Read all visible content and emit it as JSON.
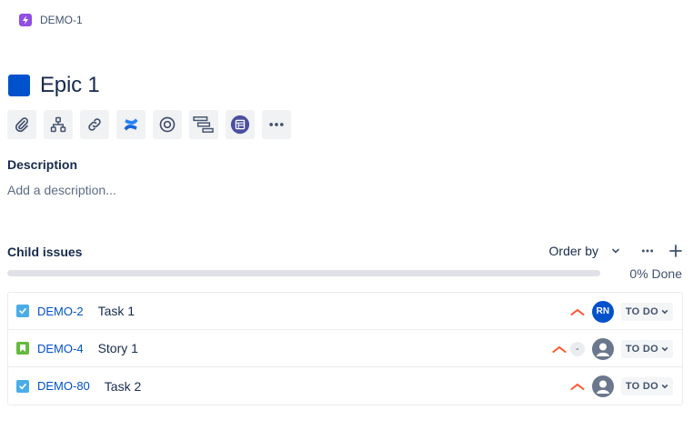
{
  "breadcrumb": {
    "key": "DEMO-1",
    "icon": "lightning-icon",
    "color": "#904ee2"
  },
  "issue": {
    "title": "Epic 1",
    "color": "#0052cc"
  },
  "toolbar": {
    "buttons": [
      "attachment-icon",
      "child-issue-icon",
      "link-icon",
      "confluence-icon",
      "target-icon",
      "roadmap-icon",
      "app-icon",
      "more-icon"
    ]
  },
  "description": {
    "label": "Description",
    "placeholder": "Add a description..."
  },
  "child_issues": {
    "label": "Child issues",
    "order_by": "Order by",
    "progress_percent": 0,
    "progress_text": "0% Done",
    "rows": [
      {
        "type": "task",
        "key": "DEMO-2",
        "summary": "Task 1",
        "priority": "high",
        "estimate": "",
        "assignee": "RN",
        "status": "TO DO"
      },
      {
        "type": "story",
        "key": "DEMO-4",
        "summary": "Story 1",
        "priority": "high",
        "estimate": "-",
        "assignee": "",
        "status": "TO DO"
      },
      {
        "type": "task",
        "key": "DEMO-80",
        "summary": "Task 2",
        "priority": "high",
        "estimate": "",
        "assignee": "",
        "status": "TO DO"
      }
    ]
  },
  "colors": {
    "task": "#4bade8",
    "story": "#63ba3c",
    "priority_high": "#ff5630",
    "link": "#0052cc"
  }
}
